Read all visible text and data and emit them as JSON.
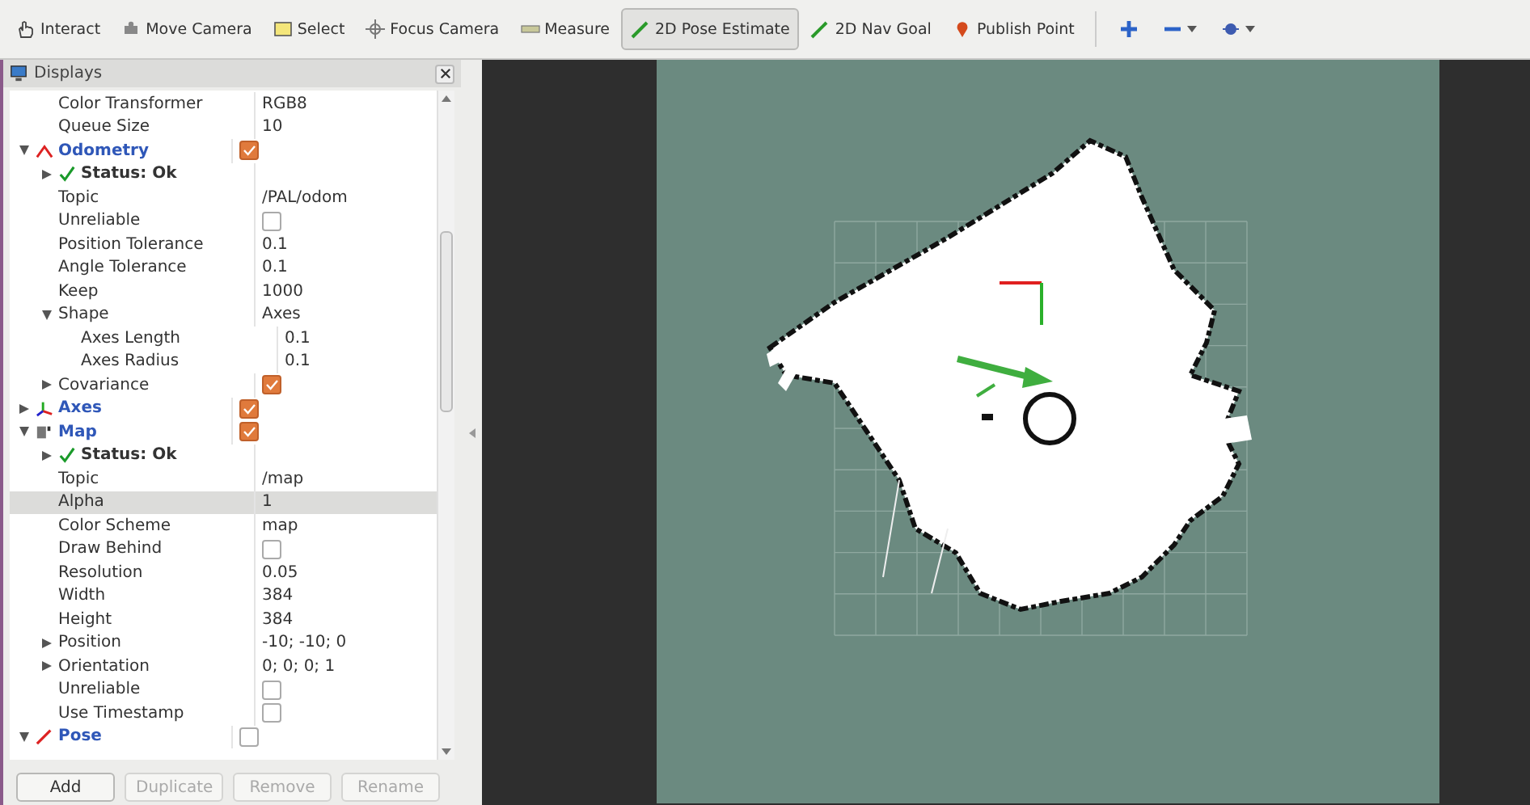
{
  "toolbar": [
    {
      "label": "Interact",
      "selected": false
    },
    {
      "label": "Move Camera",
      "selected": false
    },
    {
      "label": "Select",
      "selected": false
    },
    {
      "label": "Focus Camera",
      "selected": false
    },
    {
      "label": "Measure",
      "selected": false
    },
    {
      "label": "2D Pose Estimate",
      "selected": true
    },
    {
      "label": "2D Nav Goal",
      "selected": false
    },
    {
      "label": "Publish Point",
      "selected": false
    }
  ],
  "displays_panel": {
    "title": "Displays",
    "tree": [
      {
        "kind": "continued",
        "children": [
          {
            "kind": "property",
            "label": "Color Transformer",
            "value": "RGB8",
            "selected": false
          },
          {
            "kind": "property",
            "label": "Queue Size",
            "value": "10",
            "selected": false
          }
        ]
      },
      {
        "kind": "odometry",
        "label": "Odometry",
        "checked": true,
        "expanded": true,
        "selected": false,
        "children": [
          {
            "kind": "status",
            "label": "Status: Ok",
            "expanded": false,
            "selected": false
          },
          {
            "kind": "property",
            "label": "Topic",
            "value": "/PAL/odom",
            "selected": false
          },
          {
            "kind": "property",
            "label": "Unreliable",
            "checked": false,
            "selected": false
          },
          {
            "kind": "property",
            "label": "Position Tolerance",
            "value": "0.1",
            "selected": false
          },
          {
            "kind": "property",
            "label": "Angle Tolerance",
            "value": "0.1",
            "selected": false
          },
          {
            "kind": "property",
            "label": "Keep",
            "value": "1000",
            "selected": false
          },
          {
            "kind": "property",
            "label": "Shape",
            "value": "Axes",
            "expanded": true,
            "selected": false,
            "children": [
              {
                "kind": "property",
                "label": "Axes Length",
                "value": "0.1",
                "selected": false
              },
              {
                "kind": "property",
                "label": "Axes Radius",
                "value": "0.1",
                "selected": false
              }
            ]
          },
          {
            "kind": "property",
            "label": "Covariance",
            "checked": true,
            "expanded": false,
            "selected": false
          }
        ]
      },
      {
        "kind": "axes",
        "label": "Axes",
        "checked": true,
        "expanded": false,
        "selected": false
      },
      {
        "kind": "map",
        "label": "Map",
        "checked": true,
        "expanded": true,
        "selected": false,
        "children": [
          {
            "kind": "status",
            "label": "Status: Ok",
            "expanded": false,
            "selected": false
          },
          {
            "kind": "property",
            "label": "Topic",
            "value": "/map",
            "selected": false
          },
          {
            "kind": "property",
            "label": "Alpha",
            "value": "1",
            "selected": true
          },
          {
            "kind": "property",
            "label": "Color Scheme",
            "value": "map",
            "selected": false
          },
          {
            "kind": "property",
            "label": "Draw Behind",
            "checked": false,
            "selected": false
          },
          {
            "kind": "property",
            "label": "Resolution",
            "value": "0.05",
            "selected": false
          },
          {
            "kind": "property",
            "label": "Width",
            "value": "384",
            "selected": false
          },
          {
            "kind": "property",
            "label": "Height",
            "value": "384",
            "selected": false
          },
          {
            "kind": "property",
            "label": "Position",
            "value": "-10; -10; 0",
            "expanded": false,
            "selected": false
          },
          {
            "kind": "property",
            "label": "Orientation",
            "value": "0; 0; 0; 1",
            "expanded": false,
            "selected": false
          },
          {
            "kind": "property",
            "label": "Unreliable",
            "checked": false,
            "selected": false
          },
          {
            "kind": "property",
            "label": "Use Timestamp",
            "checked": false,
            "selected": false
          }
        ]
      },
      {
        "kind": "pose",
        "label": "Pose",
        "checked": false,
        "expanded": true,
        "selected": false
      }
    ],
    "buttons": [
      {
        "label": "Add",
        "disabled": false
      },
      {
        "label": "Duplicate",
        "disabled": true
      },
      {
        "label": "Remove",
        "disabled": true
      },
      {
        "label": "Rename",
        "disabled": true
      }
    ]
  }
}
